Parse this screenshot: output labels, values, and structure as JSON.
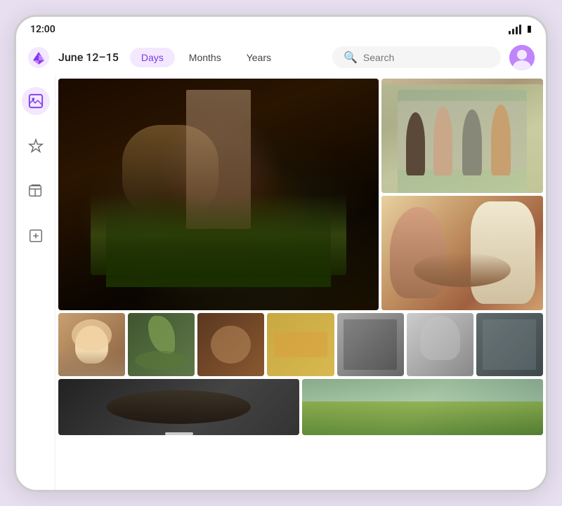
{
  "status_bar": {
    "time": "12:00"
  },
  "header": {
    "date_label": "June 12–15",
    "tabs": [
      {
        "id": "days",
        "label": "Days",
        "active": true
      },
      {
        "id": "months",
        "label": "Months",
        "active": false
      },
      {
        "id": "years",
        "label": "Years",
        "active": false
      }
    ],
    "search_placeholder": "Search"
  },
  "sidebar": {
    "items": [
      {
        "id": "photos",
        "icon": "🖼",
        "active": true
      },
      {
        "id": "favorites",
        "icon": "☆",
        "active": false
      },
      {
        "id": "albums",
        "icon": "⊞",
        "active": false
      },
      {
        "id": "messages",
        "icon": "☐",
        "active": false
      }
    ]
  },
  "photos": {
    "main_grid": {
      "large_left_alt": "Hands cooking food in a pan",
      "top_right_alt": "Group of friends sitting around a table",
      "bottom_right_alt": "People eating at a restaurant"
    },
    "thumbnails": [
      {
        "alt": "Person eating"
      },
      {
        "alt": "Flowers on table"
      },
      {
        "alt": "Food close-up"
      },
      {
        "alt": "Hands with food"
      },
      {
        "alt": "Black and white group"
      },
      {
        "alt": "Black and white portrait"
      },
      {
        "alt": "Vintage blue photo"
      }
    ],
    "bottom_row": [
      {
        "alt": "Dark food photo"
      },
      {
        "alt": "Green outdoor scene"
      }
    ]
  }
}
